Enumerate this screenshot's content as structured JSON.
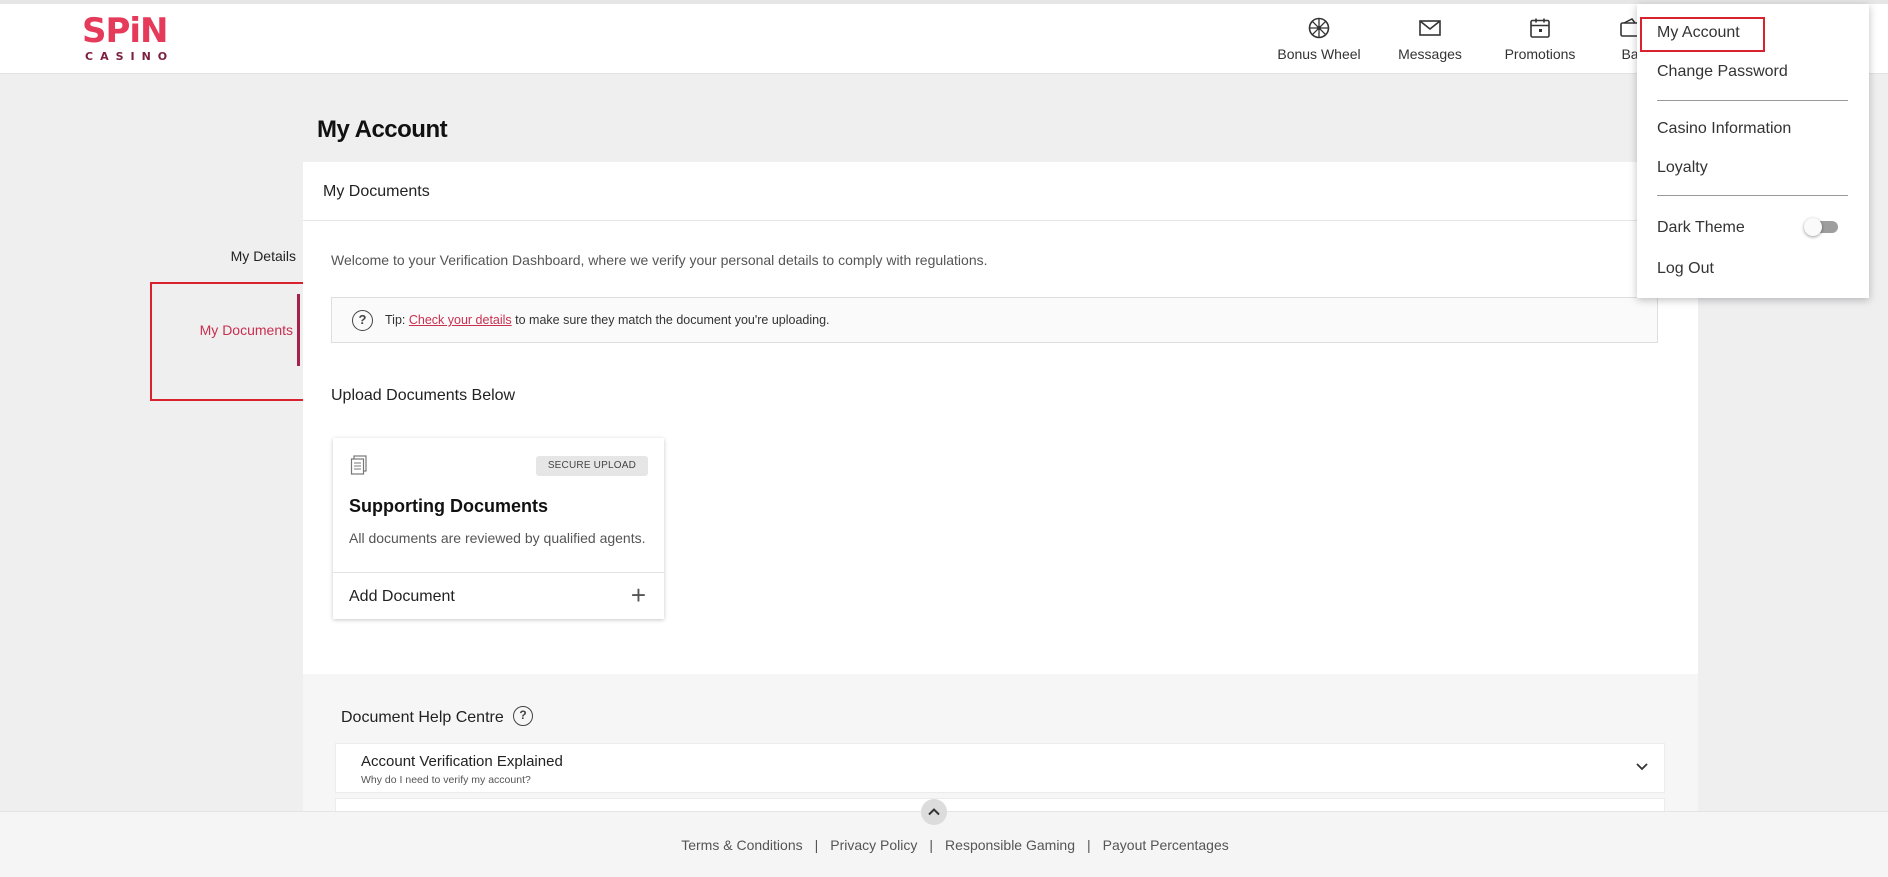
{
  "header": {
    "logo": {
      "top": "SPiN",
      "bottom": "CASINO"
    },
    "nav": [
      {
        "label": "Bonus Wheel",
        "icon": "wheel-icon"
      },
      {
        "label": "Messages",
        "icon": "envelope-icon"
      },
      {
        "label": "Promotions",
        "icon": "calendar-icon"
      },
      {
        "label": "Ba",
        "icon": "wallet-icon"
      }
    ]
  },
  "page": {
    "title": "My Account"
  },
  "sidebar": {
    "tabs": [
      {
        "label": "My Details"
      },
      {
        "label": "My Documents",
        "active": true
      }
    ]
  },
  "main": {
    "card_title": "My Documents",
    "welcome": "Welcome to your Verification Dashboard, where we verify your personal details to comply with regulations.",
    "tip": {
      "prefix": "Tip: ",
      "link": "Check your details",
      "suffix": " to make sure they match the document you're uploading."
    },
    "upload_title": "Upload Documents Below",
    "doc_card": {
      "badge": "SECURE UPLOAD",
      "title": "Supporting Documents",
      "subtitle": "All documents are reviewed by qualified agents.",
      "add_label": "Add Document"
    },
    "help": {
      "title": "Document Help Centre",
      "items": [
        {
          "title": "Account Verification Explained",
          "subtitle": "Why do I need to verify my account?"
        }
      ]
    }
  },
  "footer": {
    "links": [
      "Terms & Conditions",
      "Privacy Policy",
      "Responsible Gaming",
      "Payout Percentages"
    ]
  },
  "dropdown": {
    "items": [
      "My Account",
      "Change Password",
      "Casino Information",
      "Loyalty",
      "Dark Theme",
      "Log Out"
    ],
    "dark_theme_on": false
  },
  "colors": {
    "accent": "#c92f4f",
    "highlight": "#d8232f",
    "logo": "#e53a5a"
  }
}
